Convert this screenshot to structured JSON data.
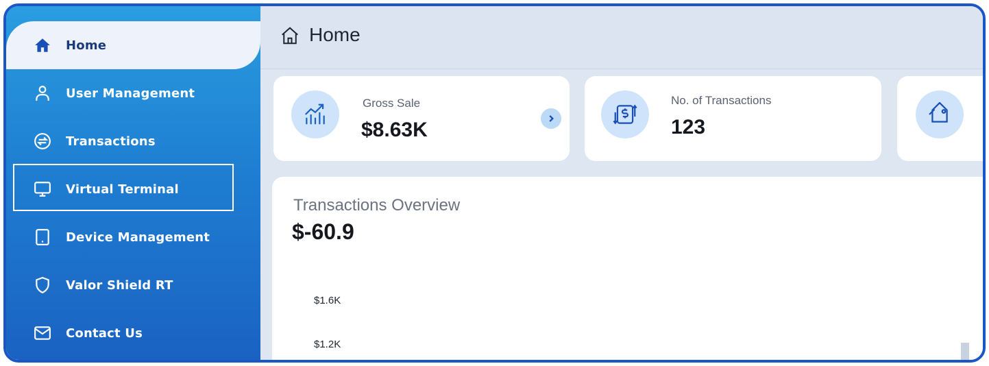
{
  "sidebar": {
    "items": [
      {
        "label": "Home",
        "icon": "home-icon",
        "active": true
      },
      {
        "label": "User Management",
        "icon": "user-icon"
      },
      {
        "label": "Transactions",
        "icon": "transfer-icon"
      },
      {
        "label": "Virtual Terminal",
        "icon": "monitor-icon",
        "highlighted": true
      },
      {
        "label": "Device Management",
        "icon": "tablet-icon"
      },
      {
        "label": "Valor Shield RT",
        "icon": "shield-icon"
      },
      {
        "label": "Contact Us",
        "icon": "mail-icon"
      }
    ]
  },
  "header": {
    "title": "Home",
    "icon": "home-outline-icon"
  },
  "cards": {
    "gross_sale": {
      "label": "Gross Sale",
      "value": "$8.63K",
      "icon": "trend-up-chart-icon"
    },
    "transactions": {
      "label": "No. of Transactions",
      "value": "123",
      "icon": "dollar-exchange-icon"
    },
    "third": {
      "icon": "tag-icon"
    }
  },
  "overview": {
    "title": "Transactions Overview",
    "value": "$-60.9",
    "y_ticks": [
      "$1.6K",
      "$1.2K"
    ]
  },
  "colors": {
    "accent": "#1a56c4",
    "sidebar_top": "#2a9de0",
    "sidebar_bottom": "#1a62c2",
    "icon_circle": "#cfe4fb"
  }
}
